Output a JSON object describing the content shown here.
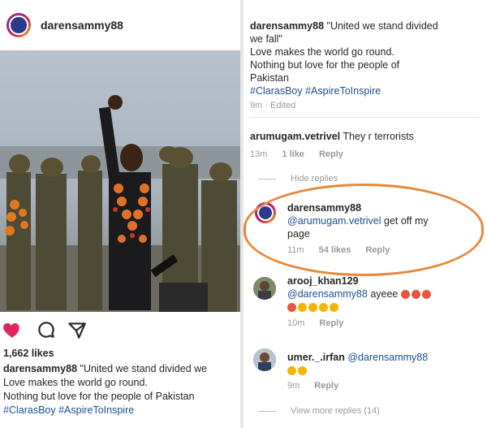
{
  "post": {
    "username": "darensammy88",
    "likes": "1,662 likes",
    "caption_user": "darensammy88",
    "caption_lines": [
      "\"United we stand divided we",
      "Love makes the world go round.",
      "Nothing but love for the people of Pakistan"
    ],
    "hashtags": "#ClarasBoy #AspireToInspire"
  },
  "comments_view": {
    "caption": {
      "user": "darensammy88",
      "line1": "\"United we stand divided",
      "line2": "we fall\"",
      "line3": "Love makes the world go round.",
      "line4": "Nothing but love for the people of",
      "line5": "Pakistan",
      "hashtags": "#ClarasBoy #AspireToInspire",
      "meta": "9m · Edited"
    },
    "comments": [
      {
        "user": "arumugam.vetrivel",
        "text": "They r terrorists",
        "time": "13m",
        "likes": "1 like",
        "reply": "Reply",
        "hide_replies": "Hide replies"
      },
      {
        "user": "darensammy88",
        "mention": "@arumugam.vetrivel",
        "text": "get off my",
        "text2": "page",
        "time": "11m",
        "likes": "54 likes",
        "reply": "Reply"
      },
      {
        "user": "arooj_khan129",
        "mention": "@darensammy88",
        "text": "ayeee",
        "time": "10m",
        "reply": "Reply"
      },
      {
        "user": "umer._.irfan",
        "mention": "@darensammy88",
        "time": "9m",
        "reply": "Reply"
      }
    ],
    "view_more": "View more replies (14)"
  },
  "colors": {
    "heart": "#e0245e",
    "hashtag": "#1d4f91",
    "highlight": "#e8873a"
  },
  "icons": [
    "heart-icon",
    "comment-icon",
    "share-icon"
  ]
}
